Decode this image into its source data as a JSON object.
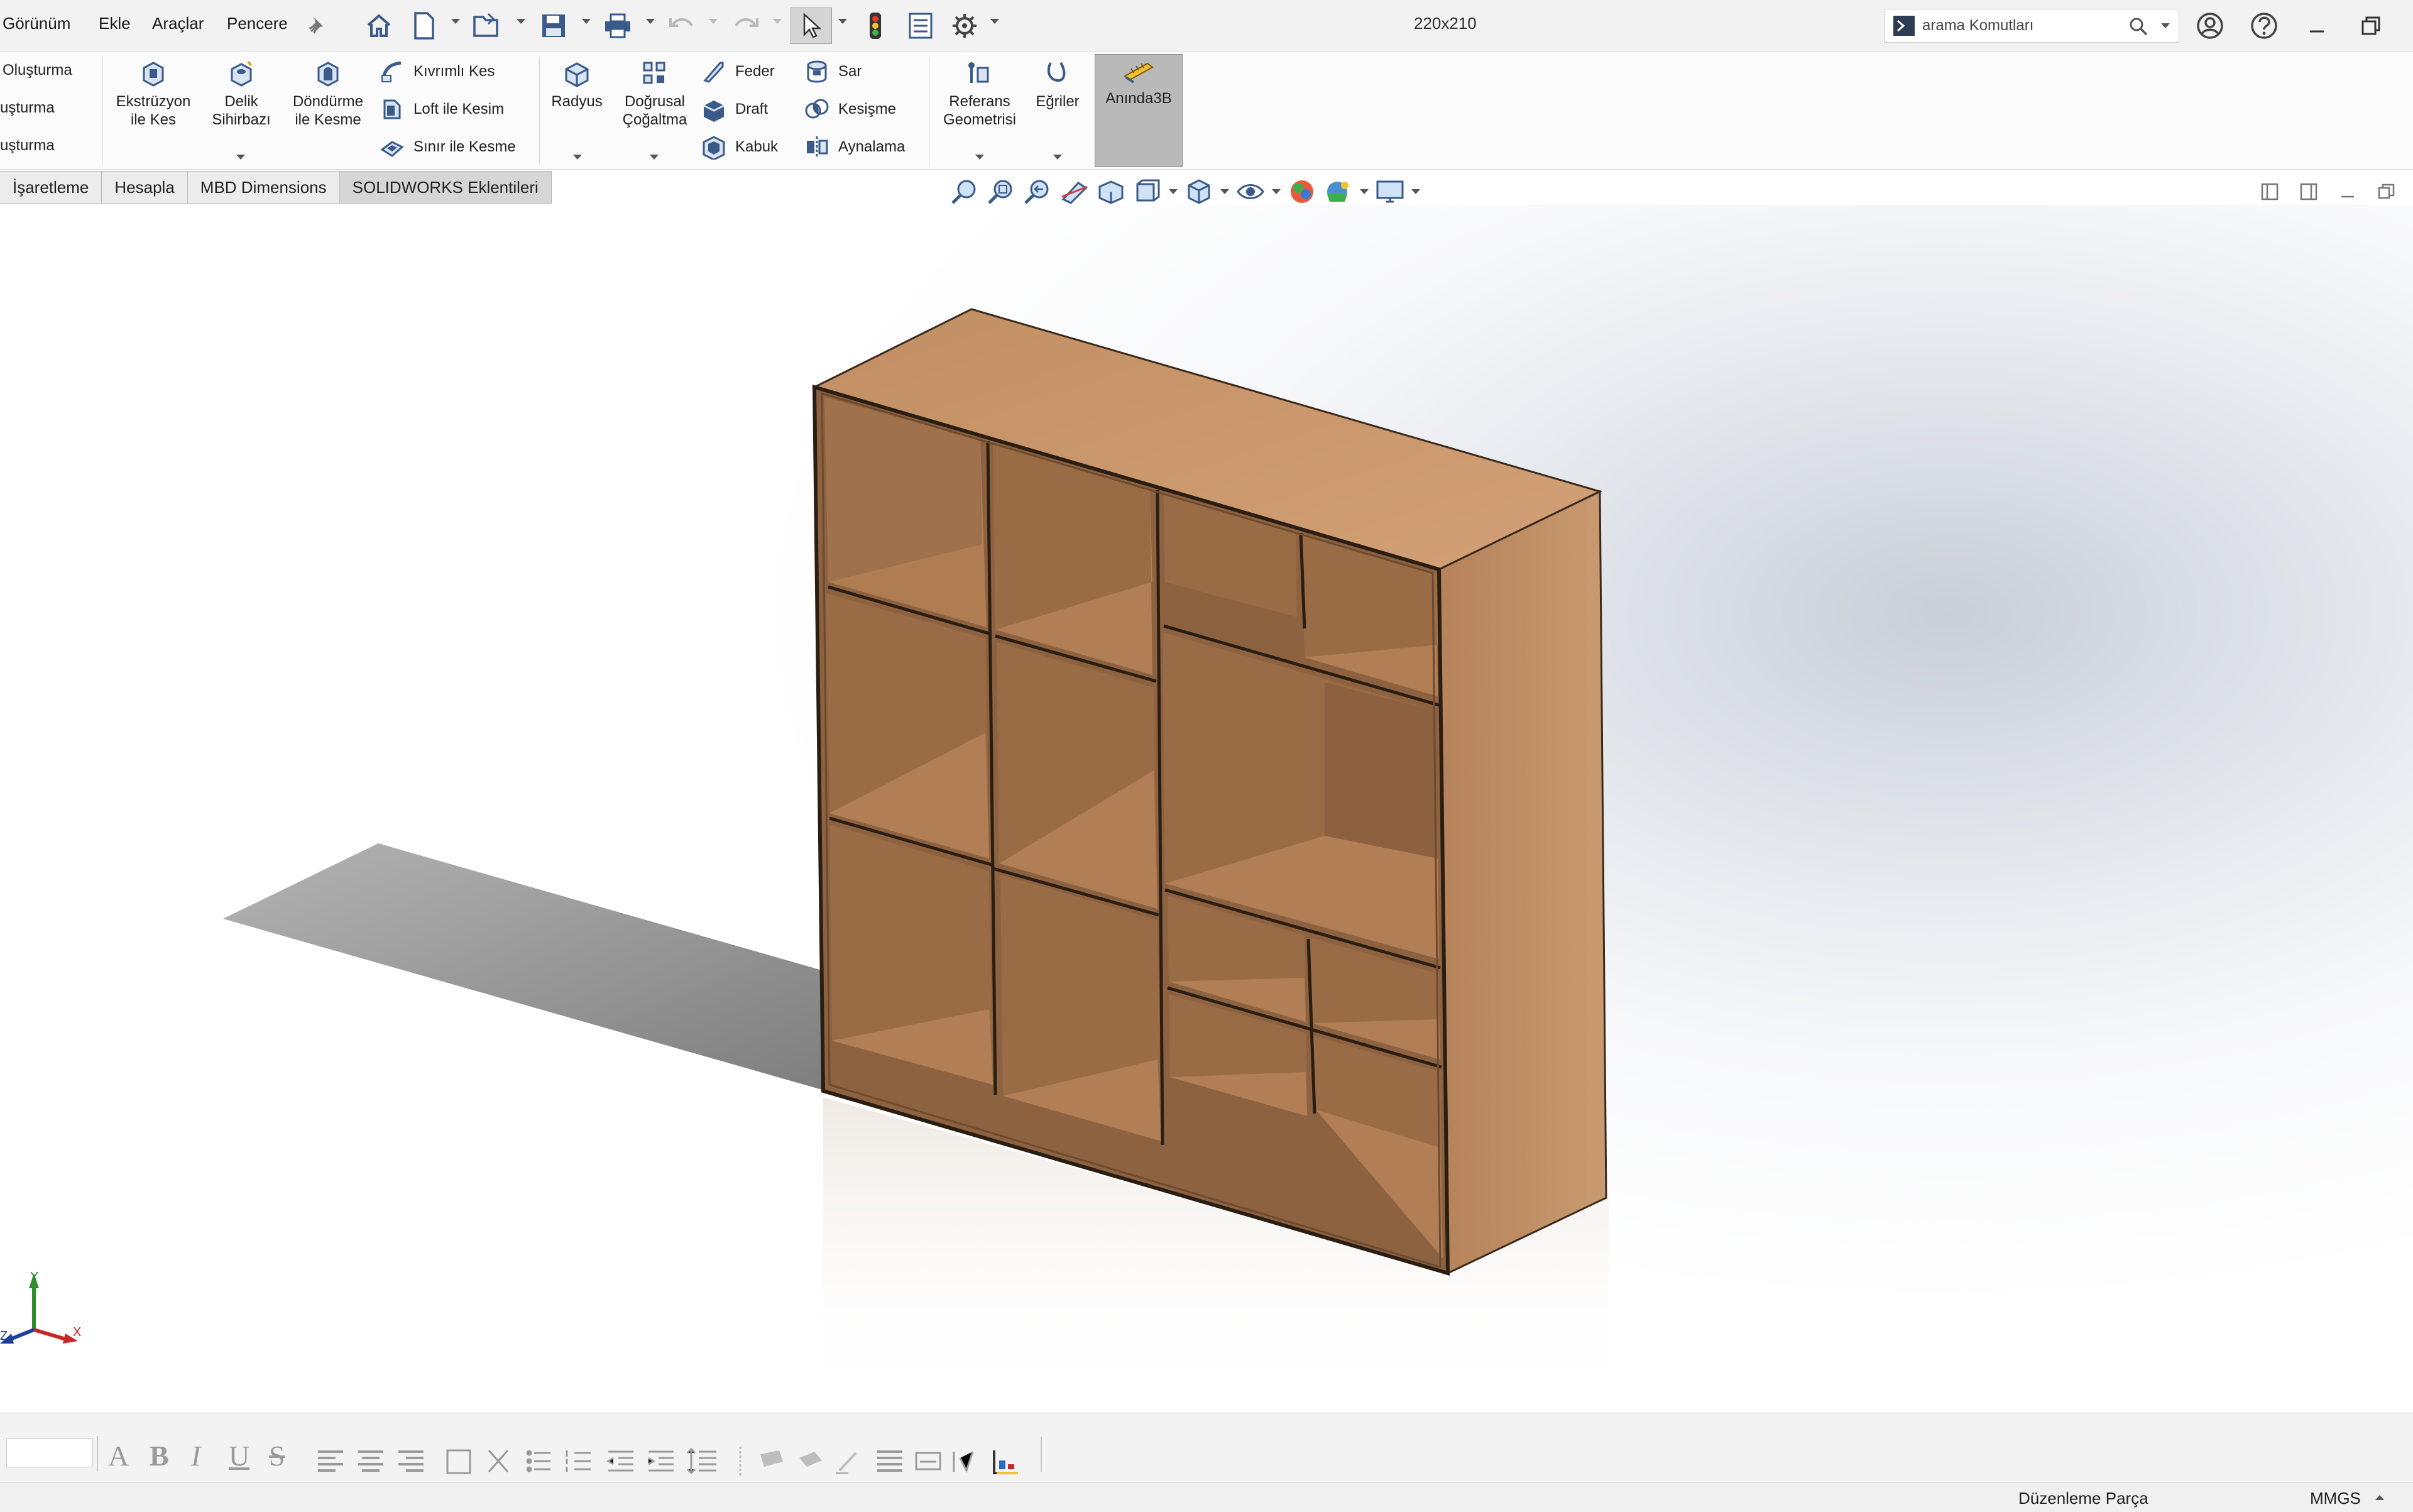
{
  "menu": {
    "items": [
      "Görünüm",
      "Ekle",
      "Araçlar",
      "Pencere"
    ],
    "pin_icon": "pin-icon"
  },
  "document": {
    "title": "220x210"
  },
  "search": {
    "placeholder": "arama Komutları"
  },
  "ribbon": {
    "left_partial": [
      "Oluşturma",
      "uşturma",
      "uşturma"
    ],
    "large": [
      {
        "line1": "Ekstrüzyon",
        "line2": "ile Kes"
      },
      {
        "line1": "Delik",
        "line2": "Sihirbazı"
      },
      {
        "line1": "Döndürme",
        "line2": "ile Kesme"
      },
      {
        "line1": "Radyus",
        "line2": ""
      },
      {
        "line1": "Doğrusal",
        "line2": "Çoğaltma"
      },
      {
        "line1": "Referans",
        "line2": "Geometrisi"
      },
      {
        "line1": "Eğriler",
        "line2": ""
      },
      {
        "line1": "Anında3B",
        "line2": ""
      }
    ],
    "small_cut": [
      "Kıvrımlı Kes",
      "Loft ile Kesim",
      "Sınır ile Kesme"
    ],
    "small_feat": [
      "Feder",
      "Draft",
      "Kabuk"
    ],
    "small_misc": [
      "Sar",
      "Kesişme",
      "Aynalama"
    ]
  },
  "tabs": [
    "İşaretleme",
    "Hesapla",
    "MBD Dimensions",
    "SOLIDWORKS Eklentileri"
  ],
  "triad": {
    "x": "X",
    "y": "Y",
    "z": "Z"
  },
  "status": {
    "mode": "Düzenleme Parça",
    "units": "MMGS"
  },
  "colors": {
    "wood_front": "#a87850",
    "wood_top": "#c9976a",
    "wood_side": "#bd8a62",
    "shadow": "#9c9c9c"
  }
}
